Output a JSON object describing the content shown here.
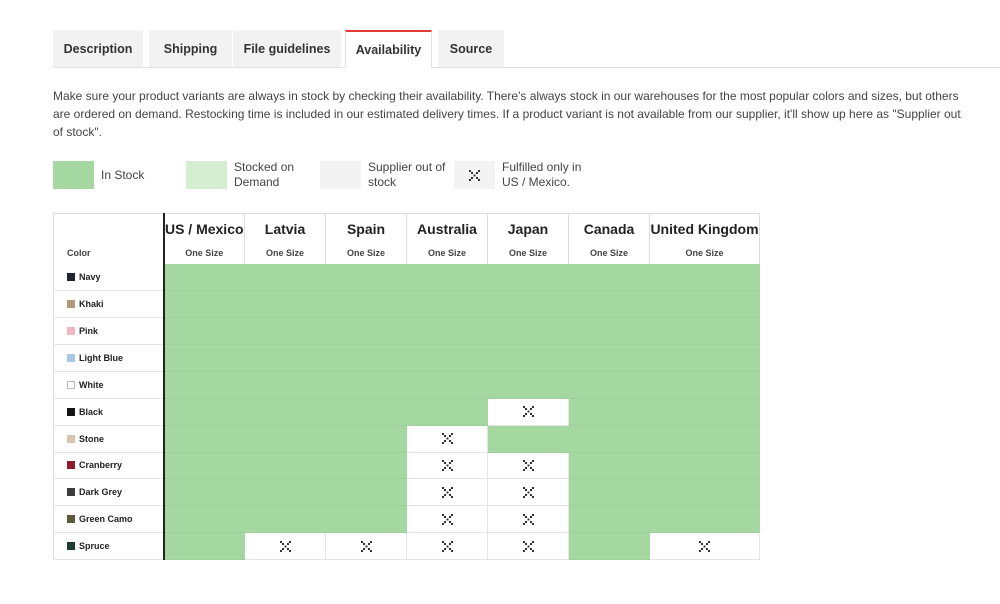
{
  "tabs": [
    "Description",
    "Shipping",
    "File guidelines",
    "Availability",
    "Source"
  ],
  "active_tab": "Availability",
  "description": "Make sure your product variants are always in stock by checking their availability. There's always stock in our warehouses for the most popular colors and sizes, but others are ordered on demand. Restocking time is included in our estimated delivery times. If a product variant is not available from our supplier, it'll show up here as \"Supplier out of stock\".",
  "legend": {
    "in_stock": "In Stock",
    "on_demand": "Stocked on Demand",
    "supplier_out": "Supplier out of stock",
    "fulfilled_us": "Fulfilled only in US / Mexico."
  },
  "table": {
    "color_header": "Color",
    "size_label": "One Size",
    "regions": [
      "US / Mexico",
      "Latvia",
      "Spain",
      "Australia",
      "Japan",
      "Canada",
      "United Kingdom"
    ],
    "rows": [
      {
        "color": "Navy",
        "swatch": "#1e2436",
        "availability": [
          "in_stock",
          "in_stock",
          "in_stock",
          "in_stock",
          "in_stock",
          "in_stock",
          "in_stock"
        ]
      },
      {
        "color": "Khaki",
        "swatch": "#b39a78",
        "availability": [
          "in_stock",
          "in_stock",
          "in_stock",
          "in_stock",
          "in_stock",
          "in_stock",
          "in_stock"
        ]
      },
      {
        "color": "Pink",
        "swatch": "#f4b6c2",
        "availability": [
          "in_stock",
          "in_stock",
          "in_stock",
          "in_stock",
          "in_stock",
          "in_stock",
          "in_stock"
        ]
      },
      {
        "color": "Light Blue",
        "swatch": "#a9c6e2",
        "availability": [
          "in_stock",
          "in_stock",
          "in_stock",
          "in_stock",
          "in_stock",
          "in_stock",
          "in_stock"
        ]
      },
      {
        "color": "White",
        "swatch": "#ffffff",
        "availability": [
          "in_stock",
          "in_stock",
          "in_stock",
          "in_stock",
          "in_stock",
          "in_stock",
          "in_stock"
        ]
      },
      {
        "color": "Black",
        "swatch": "#151515",
        "availability": [
          "in_stock",
          "in_stock",
          "in_stock",
          "in_stock",
          "fulfilled_us_only",
          "in_stock",
          "in_stock"
        ]
      },
      {
        "color": "Stone",
        "swatch": "#d9c4b0",
        "availability": [
          "in_stock",
          "in_stock",
          "in_stock",
          "fulfilled_us_only",
          "in_stock",
          "in_stock",
          "in_stock"
        ]
      },
      {
        "color": "Cranberry",
        "swatch": "#8e1a2a",
        "availability": [
          "in_stock",
          "in_stock",
          "in_stock",
          "fulfilled_us_only",
          "fulfilled_us_only",
          "in_stock",
          "in_stock"
        ]
      },
      {
        "color": "Dark Grey",
        "swatch": "#3c3c3e",
        "availability": [
          "in_stock",
          "in_stock",
          "in_stock",
          "fulfilled_us_only",
          "fulfilled_us_only",
          "in_stock",
          "in_stock"
        ]
      },
      {
        "color": "Green Camo",
        "swatch": "#5b5a3a",
        "availability": [
          "in_stock",
          "in_stock",
          "in_stock",
          "fulfilled_us_only",
          "fulfilled_us_only",
          "in_stock",
          "in_stock"
        ]
      },
      {
        "color": "Spruce",
        "swatch": "#1e3b2e",
        "availability": [
          "in_stock",
          "fulfilled_us_only",
          "fulfilled_us_only",
          "fulfilled_us_only",
          "fulfilled_us_only",
          "in_stock",
          "fulfilled_us_only"
        ]
      }
    ]
  },
  "colors": {
    "in_stock": "#a5d8a0",
    "on_demand": "#d5eed2",
    "supplier_out": "#f3f3f3",
    "active_tab_accent": "#e53935"
  },
  "icons": {
    "fulfilled_us_only": "x-cross-icon"
  }
}
